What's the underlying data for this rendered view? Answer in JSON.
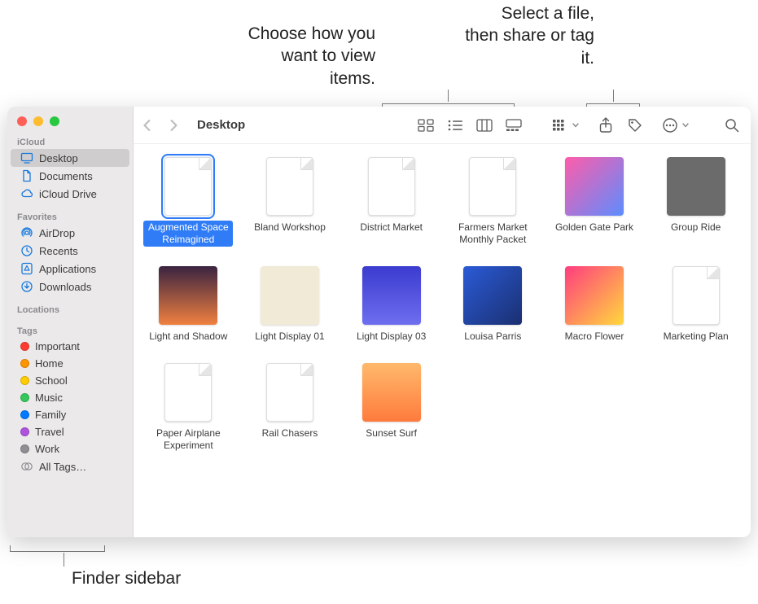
{
  "callouts": {
    "view": "Choose how you\nwant to view items.",
    "shareTag": "Select a file,\nthen share\nor tag it.",
    "sidebar": "Finder sidebar"
  },
  "window": {
    "title": "Desktop"
  },
  "sidebar": {
    "sections": [
      {
        "title": "iCloud",
        "items": [
          {
            "id": "desktop",
            "icon": "desktop",
            "label": "Desktop",
            "selected": true
          },
          {
            "id": "documents",
            "icon": "doc",
            "label": "Documents"
          },
          {
            "id": "iclouddrive",
            "icon": "cloud",
            "label": "iCloud Drive"
          }
        ]
      },
      {
        "title": "Favorites",
        "items": [
          {
            "id": "airdrop",
            "icon": "airdrop",
            "label": "AirDrop"
          },
          {
            "id": "recents",
            "icon": "clock",
            "label": "Recents"
          },
          {
            "id": "applications",
            "icon": "apps",
            "label": "Applications"
          },
          {
            "id": "downloads",
            "icon": "downloads",
            "label": "Downloads"
          }
        ]
      },
      {
        "title": "Locations",
        "items": []
      },
      {
        "title": "Tags",
        "items": [
          {
            "id": "tag-important",
            "icon": "tag",
            "color": "#ff3b30",
            "label": "Important"
          },
          {
            "id": "tag-home",
            "icon": "tag",
            "color": "#ff9500",
            "label": "Home"
          },
          {
            "id": "tag-school",
            "icon": "tag",
            "color": "#ffcc00",
            "label": "School"
          },
          {
            "id": "tag-music",
            "icon": "tag",
            "color": "#34c759",
            "label": "Music"
          },
          {
            "id": "tag-family",
            "icon": "tag",
            "color": "#007aff",
            "label": "Family"
          },
          {
            "id": "tag-travel",
            "icon": "tag",
            "color": "#af52de",
            "label": "Travel"
          },
          {
            "id": "tag-work",
            "icon": "tag",
            "color": "#8e8e93",
            "label": "Work"
          },
          {
            "id": "tag-all",
            "icon": "alltags",
            "label": "All Tags…"
          }
        ]
      }
    ]
  },
  "files": [
    {
      "name": "Augmented Space Reimagined",
      "selected": true,
      "thumbClass": "c1",
      "doc": true
    },
    {
      "name": "Bland Workshop",
      "thumbClass": "c2",
      "doc": true
    },
    {
      "name": "District Market",
      "thumbClass": "c3",
      "doc": true
    },
    {
      "name": "Farmers Market Monthly Packet",
      "thumbClass": "c4",
      "doc": true
    },
    {
      "name": "Golden Gate Park",
      "thumbClass": "c5"
    },
    {
      "name": "Group Ride",
      "thumbClass": "c6"
    },
    {
      "name": "Light and Shadow",
      "thumbClass": "c7"
    },
    {
      "name": "Light Display 01",
      "thumbClass": "c8"
    },
    {
      "name": "Light Display 03",
      "thumbClass": "c9"
    },
    {
      "name": "Louisa Parris",
      "thumbClass": "c10"
    },
    {
      "name": "Macro Flower",
      "thumbClass": "c11"
    },
    {
      "name": "Marketing Plan",
      "thumbClass": "c12",
      "doc": true
    },
    {
      "name": "Paper Airplane Experiment",
      "thumbClass": "c13",
      "doc": true
    },
    {
      "name": "Rail Chasers",
      "thumbClass": "c14",
      "doc": true
    },
    {
      "name": "Sunset Surf",
      "thumbClass": "c15"
    }
  ]
}
